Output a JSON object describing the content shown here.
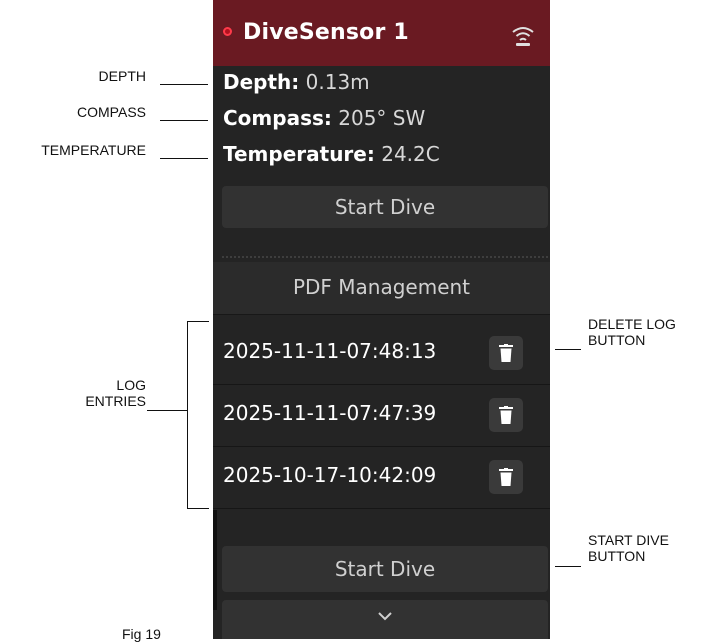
{
  "device": {
    "title": "DiveSensor 1",
    "connection_icon": "wireless-signal-icon",
    "status_color": "#ff3a4a"
  },
  "readouts": {
    "depth_label": "Depth:",
    "depth_value": "0.13m",
    "compass_label": "Compass:",
    "compass_value": "205° SW",
    "temperature_label": "Temperature:",
    "temperature_value": "24.2C"
  },
  "buttons": {
    "start_dive_top": "Start Dive",
    "pdf_management": "PDF Management",
    "start_dive_bottom": "Start Dive"
  },
  "log_entries": [
    {
      "timestamp": "2025-11-11-07:48:13",
      "icon": "trash-icon"
    },
    {
      "timestamp": "2025-11-11-07:47:39",
      "icon": "trash-icon"
    },
    {
      "timestamp": "2025-10-17-10:42:09",
      "icon": "trash-icon"
    }
  ],
  "annotations": {
    "depth": "DEPTH",
    "compass": "COMPASS",
    "temperature": "TEMPERATURE",
    "log_entries_line1": "LOG",
    "log_entries_line2": "ENTRIES",
    "delete_log_line1": "DELETE LOG",
    "delete_log_line2": "BUTTON",
    "start_dive_line1": "START DIVE",
    "start_dive_line2": "BUTTON",
    "figure_caption": "Fig 19"
  },
  "colors": {
    "titlebar": "#6a1a22",
    "panel_bg": "#242424",
    "button_bg": "#323232"
  }
}
